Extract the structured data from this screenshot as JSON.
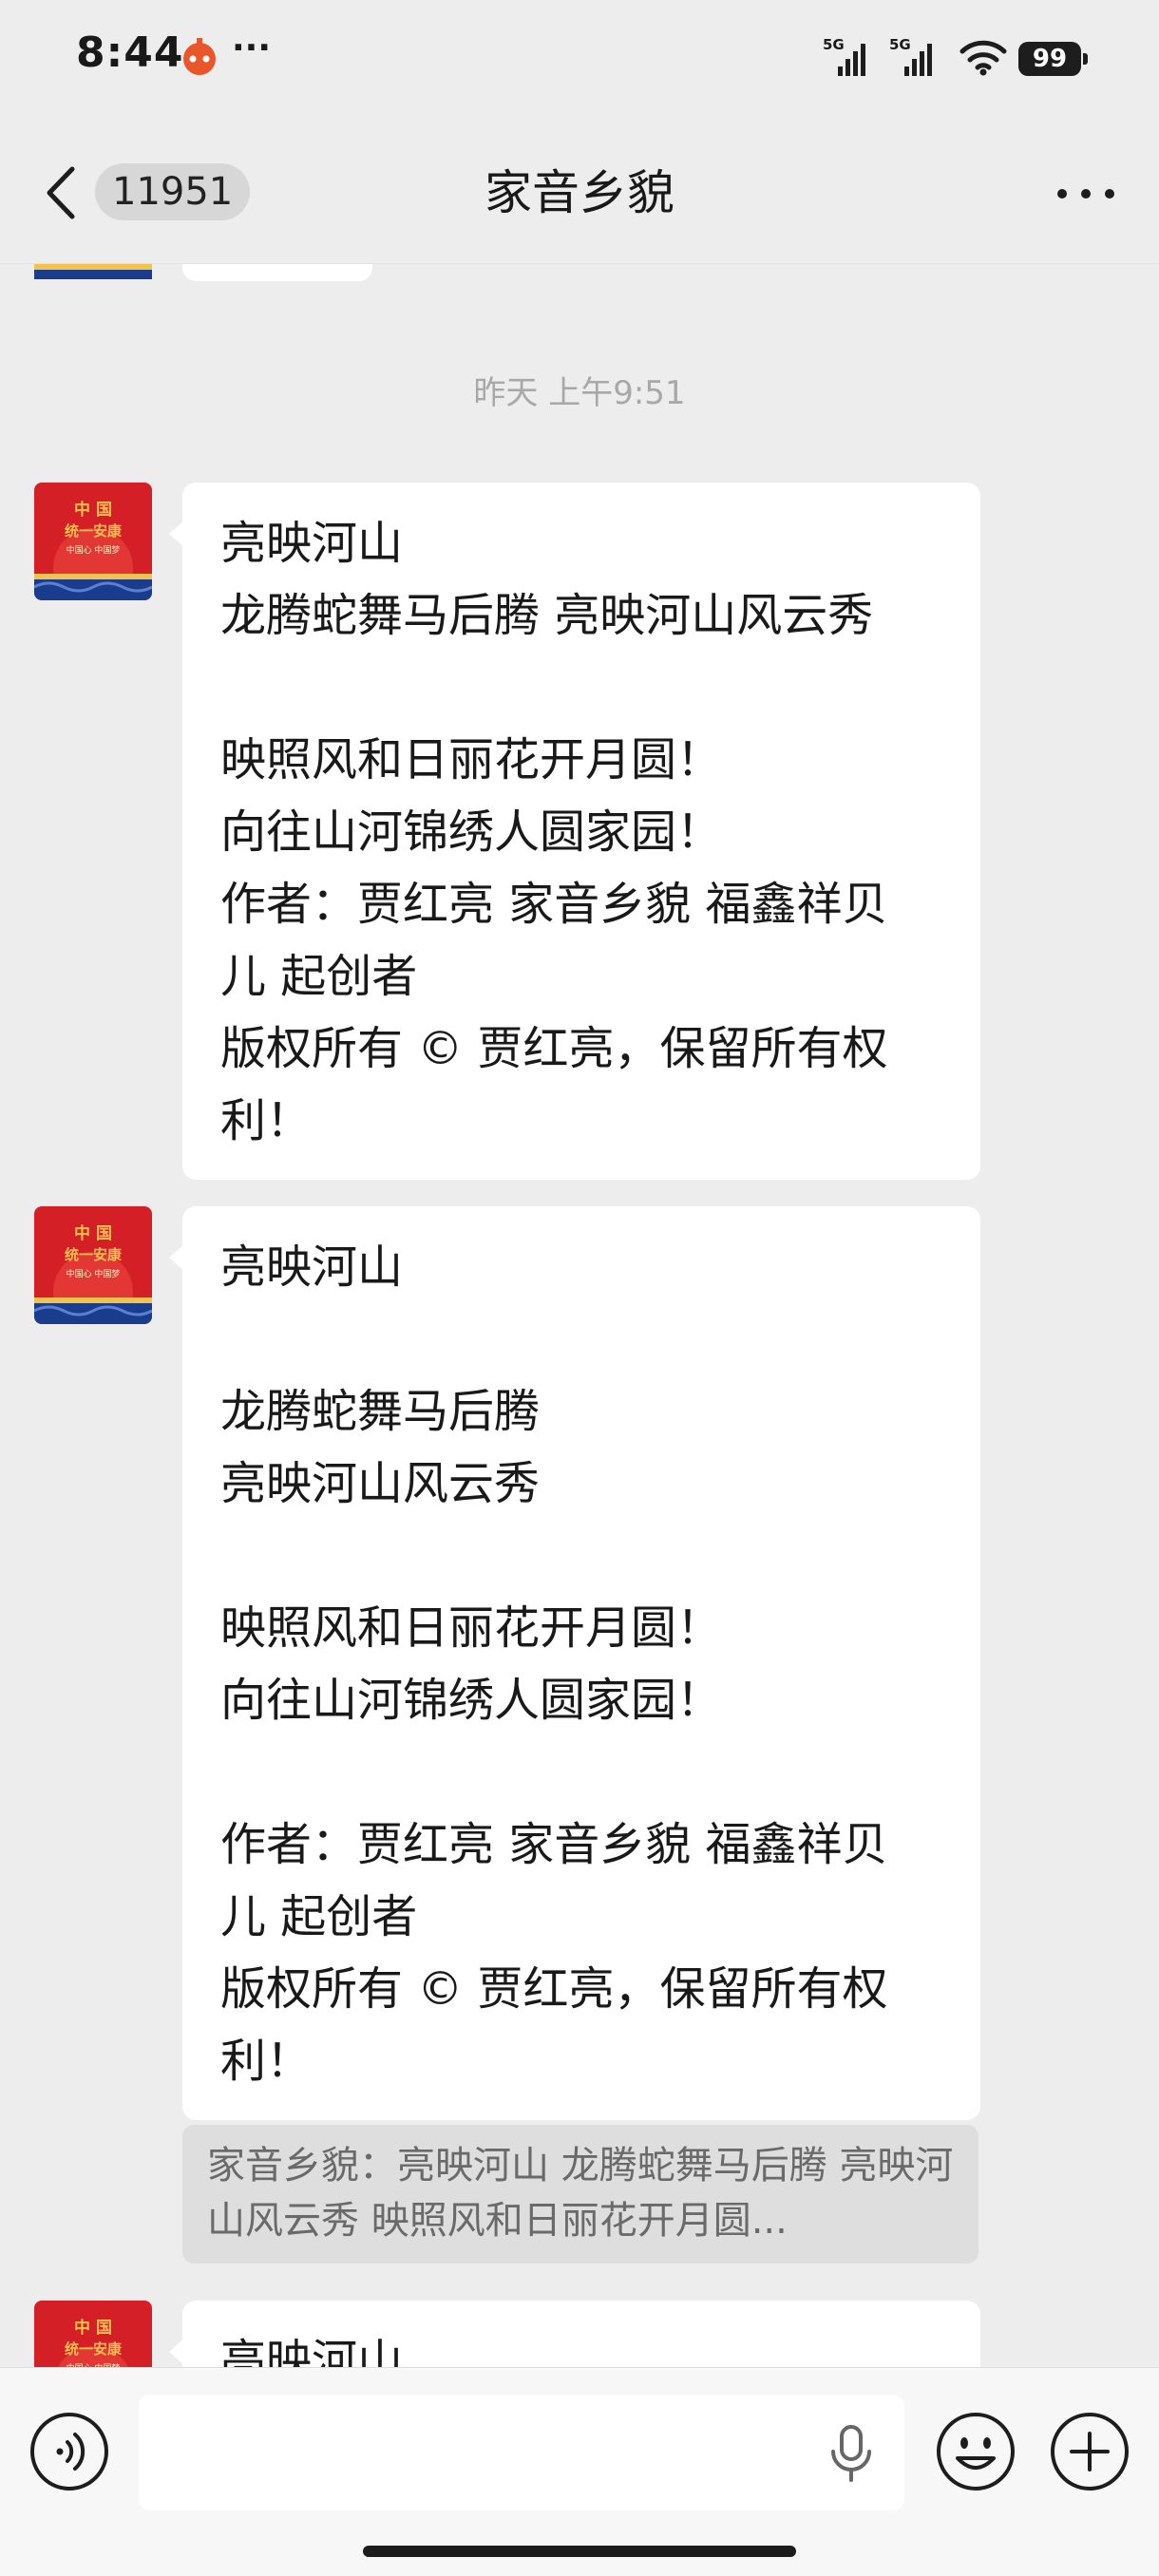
{
  "status_bar": {
    "time": "8:44",
    "dots": "···",
    "signal_1": "5G",
    "signal_2": "5G",
    "battery": "99"
  },
  "header": {
    "unread_count": "11951",
    "title": "家音乡貌"
  },
  "timestamp": "昨天 上午9:51",
  "messages": [
    {
      "lines": [
        "亮映河山",
        "龙腾蛇舞马后腾 亮映河山风云秀",
        "",
        "映照风和日丽花开月圆！",
        "向往山河锦绣人圆家园！",
        "作者：贾红亮 家音乡貌 福鑫祥贝",
        "儿 起创者",
        "版权所有 © 贾红亮，保留所有权",
        "利！"
      ]
    },
    {
      "lines": [
        "亮映河山",
        "",
        "龙腾蛇舞马后腾",
        "亮映河山风云秀",
        "",
        "映照风和日丽花开月圆！",
        "向往山河锦绣人圆家园！",
        "",
        "作者：贾红亮 家音乡貌 福鑫祥贝",
        "儿 起创者",
        "版权所有 © 贾红亮，保留所有权",
        "利！"
      ]
    },
    {
      "lines": [
        "亮映河山"
      ]
    }
  ],
  "quote": "家音乡貌：亮映河山 龙腾蛇舞马后腾 亮映河山风云秀  映照风和日丽花开月圆...",
  "avatar_text": {
    "line1": "中 国",
    "line2": "统一安康",
    "line3": "中国心 中国梦"
  },
  "colors": {
    "background": "#ededed",
    "bubble": "#ffffff",
    "avatar_red": "#d41f26",
    "avatar_blue": "#1a3c8c",
    "avatar_gold": "#f2c14e"
  },
  "icons": {
    "back": "chevron-left-icon",
    "more": "ellipsis-icon",
    "voice": "voice-icon",
    "mic": "microphone-icon",
    "emoji": "emoji-icon",
    "plus": "plus-icon"
  }
}
